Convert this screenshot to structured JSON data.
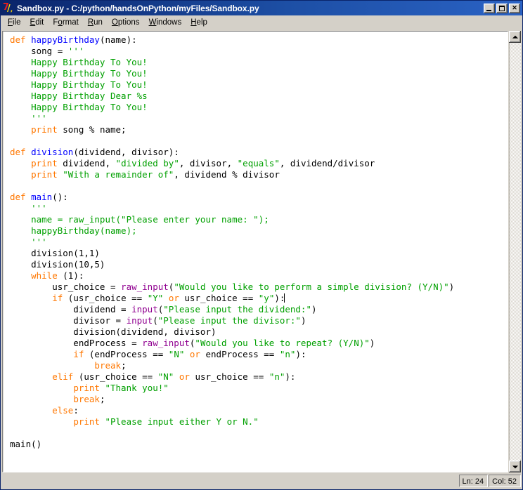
{
  "window": {
    "title": "Sandbox.py - C:/python/handsOnPython/myFiles/Sandbox.py",
    "icon": "python-logo-icon",
    "controls": {
      "minimize": "minimize-icon",
      "maximize": "maximize-icon",
      "close": "close-icon"
    }
  },
  "menubar": {
    "items": [
      {
        "label": "File",
        "accel": "F"
      },
      {
        "label": "Edit",
        "accel": "E"
      },
      {
        "label": "Format",
        "accel": "o"
      },
      {
        "label": "Run",
        "accel": "R"
      },
      {
        "label": "Options",
        "accel": "O"
      },
      {
        "label": "Windows",
        "accel": "W"
      },
      {
        "label": "Help",
        "accel": "H"
      }
    ]
  },
  "statusbar": {
    "line_label": "Ln: 24",
    "col_label": "Col: 52"
  },
  "scrollbar": {
    "up_icon": "scroll-up-arrow-icon",
    "down_icon": "scroll-down-arrow-icon"
  },
  "colors": {
    "keyword": "#ff7700",
    "definition": "#0000ff",
    "string": "#00a000",
    "builtin": "#900090",
    "plain": "#000000",
    "titlebar": "#0a246a",
    "chrome": "#d4d0c8",
    "editor_bg": "#ffffff"
  },
  "editor": {
    "filename": "Sandbox.py",
    "cursor_line": 24,
    "cursor_col": 52,
    "code_text": "def happyBirthday(name):\n    song = '''\n    Happy Birthday To You!\n    Happy Birthday To You!\n    Happy Birthday To You!\n    Happy Birthday Dear %s\n    Happy Birthday To You!\n    '''\n    print song % name;\n\ndef division(dividend, divisor):\n    print dividend, \"divided by\", divisor, \"equals\", dividend/divisor\n    print \"With a remainder of\", dividend % divisor\n\ndef main():\n    '''\n    name = raw_input(\"Please enter your name: \");\n    happyBirthday(name);\n    '''\n    division(1,1)\n    division(10,5)\n    while (1):\n        usr_choice = raw_input(\"Would you like to perform a simple division? (Y/N)\")\n        if (usr_choice == \"Y\" or usr_choice == \"y\"):\n            dividend = input(\"Please input the dividend:\")\n            divisor = input(\"Please input the divisor:\")\n            division(dividend, divisor)\n            endProcess = raw_input(\"Would you like to repeat? (Y/N)\")\n            if (endProcess == \"N\" or endProcess == \"n\"):\n                break;\n        elif (usr_choice == \"N\" or usr_choice == \"n\"):\n            print \"Thank you!\"\n            break;\n        else:\n            print \"Please input either Y or N.\"\n\nmain()",
    "lines": [
      {
        "n": 1,
        "tokens": [
          {
            "t": "def",
            "c": "kw"
          },
          {
            "t": " ",
            "c": "pl"
          },
          {
            "t": "happyBirthday",
            "c": "fn"
          },
          {
            "t": "(name):",
            "c": "pl"
          }
        ]
      },
      {
        "n": 2,
        "tokens": [
          {
            "t": "    song = ",
            "c": "pl"
          },
          {
            "t": "'''",
            "c": "str"
          }
        ]
      },
      {
        "n": 3,
        "tokens": [
          {
            "t": "    Happy Birthday To You!",
            "c": "str"
          }
        ]
      },
      {
        "n": 4,
        "tokens": [
          {
            "t": "    Happy Birthday To You!",
            "c": "str"
          }
        ]
      },
      {
        "n": 5,
        "tokens": [
          {
            "t": "    Happy Birthday To You!",
            "c": "str"
          }
        ]
      },
      {
        "n": 6,
        "tokens": [
          {
            "t": "    Happy Birthday Dear %s",
            "c": "str"
          }
        ]
      },
      {
        "n": 7,
        "tokens": [
          {
            "t": "    Happy Birthday To You!",
            "c": "str"
          }
        ]
      },
      {
        "n": 8,
        "tokens": [
          {
            "t": "    ",
            "c": "pl"
          },
          {
            "t": "'''",
            "c": "str"
          }
        ]
      },
      {
        "n": 9,
        "tokens": [
          {
            "t": "    ",
            "c": "pl"
          },
          {
            "t": "print",
            "c": "kw"
          },
          {
            "t": " song % name;",
            "c": "pl"
          }
        ]
      },
      {
        "n": 10,
        "tokens": []
      },
      {
        "n": 11,
        "tokens": [
          {
            "t": "def",
            "c": "kw"
          },
          {
            "t": " ",
            "c": "pl"
          },
          {
            "t": "division",
            "c": "fn"
          },
          {
            "t": "(dividend, divisor):",
            "c": "pl"
          }
        ]
      },
      {
        "n": 12,
        "tokens": [
          {
            "t": "    ",
            "c": "pl"
          },
          {
            "t": "print",
            "c": "kw"
          },
          {
            "t": " dividend, ",
            "c": "pl"
          },
          {
            "t": "\"divided by\"",
            "c": "str"
          },
          {
            "t": ", divisor, ",
            "c": "pl"
          },
          {
            "t": "\"equals\"",
            "c": "str"
          },
          {
            "t": ", dividend/divisor",
            "c": "pl"
          }
        ]
      },
      {
        "n": 13,
        "tokens": [
          {
            "t": "    ",
            "c": "pl"
          },
          {
            "t": "print",
            "c": "kw"
          },
          {
            "t": " ",
            "c": "pl"
          },
          {
            "t": "\"With a remainder of\"",
            "c": "str"
          },
          {
            "t": ", dividend % divisor",
            "c": "pl"
          }
        ]
      },
      {
        "n": 14,
        "tokens": []
      },
      {
        "n": 15,
        "tokens": [
          {
            "t": "def",
            "c": "kw"
          },
          {
            "t": " ",
            "c": "pl"
          },
          {
            "t": "main",
            "c": "fn"
          },
          {
            "t": "():",
            "c": "pl"
          }
        ]
      },
      {
        "n": 16,
        "tokens": [
          {
            "t": "    ",
            "c": "pl"
          },
          {
            "t": "'''",
            "c": "str"
          }
        ]
      },
      {
        "n": 17,
        "tokens": [
          {
            "t": "    name = raw_input(\"Please enter your name: \");",
            "c": "str"
          }
        ]
      },
      {
        "n": 18,
        "tokens": [
          {
            "t": "    happyBirthday(name);",
            "c": "str"
          }
        ]
      },
      {
        "n": 19,
        "tokens": [
          {
            "t": "    ",
            "c": "pl"
          },
          {
            "t": "'''",
            "c": "str"
          }
        ]
      },
      {
        "n": 20,
        "tokens": [
          {
            "t": "    division(1,1)",
            "c": "pl"
          }
        ]
      },
      {
        "n": 21,
        "tokens": [
          {
            "t": "    division(10,5)",
            "c": "pl"
          }
        ]
      },
      {
        "n": 22,
        "tokens": [
          {
            "t": "    ",
            "c": "pl"
          },
          {
            "t": "while",
            "c": "kw"
          },
          {
            "t": " (1):",
            "c": "pl"
          }
        ]
      },
      {
        "n": 23,
        "tokens": [
          {
            "t": "        usr_choice = ",
            "c": "pl"
          },
          {
            "t": "raw_input",
            "c": "bi"
          },
          {
            "t": "(",
            "c": "pl"
          },
          {
            "t": "\"Would you like to perform a simple division? (Y/N)\"",
            "c": "str"
          },
          {
            "t": ")",
            "c": "pl"
          }
        ]
      },
      {
        "n": 24,
        "tokens": [
          {
            "t": "        ",
            "c": "pl"
          },
          {
            "t": "if",
            "c": "kw"
          },
          {
            "t": " (usr_choice == ",
            "c": "pl"
          },
          {
            "t": "\"Y\"",
            "c": "str"
          },
          {
            "t": " ",
            "c": "pl"
          },
          {
            "t": "or",
            "c": "kw"
          },
          {
            "t": " usr_choice == ",
            "c": "pl"
          },
          {
            "t": "\"y\"",
            "c": "str"
          },
          {
            "t": "):",
            "c": "pl"
          }
        ],
        "caret": true
      },
      {
        "n": 25,
        "tokens": [
          {
            "t": "            dividend = ",
            "c": "pl"
          },
          {
            "t": "input",
            "c": "bi"
          },
          {
            "t": "(",
            "c": "pl"
          },
          {
            "t": "\"Please input the dividend:\"",
            "c": "str"
          },
          {
            "t": ")",
            "c": "pl"
          }
        ]
      },
      {
        "n": 26,
        "tokens": [
          {
            "t": "            divisor = ",
            "c": "pl"
          },
          {
            "t": "input",
            "c": "bi"
          },
          {
            "t": "(",
            "c": "pl"
          },
          {
            "t": "\"Please input the divisor:\"",
            "c": "str"
          },
          {
            "t": ")",
            "c": "pl"
          }
        ]
      },
      {
        "n": 27,
        "tokens": [
          {
            "t": "            division(dividend, divisor)",
            "c": "pl"
          }
        ]
      },
      {
        "n": 28,
        "tokens": [
          {
            "t": "            endProcess = ",
            "c": "pl"
          },
          {
            "t": "raw_input",
            "c": "bi"
          },
          {
            "t": "(",
            "c": "pl"
          },
          {
            "t": "\"Would you like to repeat? (Y/N)\"",
            "c": "str"
          },
          {
            "t": ")",
            "c": "pl"
          }
        ]
      },
      {
        "n": 29,
        "tokens": [
          {
            "t": "            ",
            "c": "pl"
          },
          {
            "t": "if",
            "c": "kw"
          },
          {
            "t": " (endProcess == ",
            "c": "pl"
          },
          {
            "t": "\"N\"",
            "c": "str"
          },
          {
            "t": " ",
            "c": "pl"
          },
          {
            "t": "or",
            "c": "kw"
          },
          {
            "t": " endProcess == ",
            "c": "pl"
          },
          {
            "t": "\"n\"",
            "c": "str"
          },
          {
            "t": "):",
            "c": "pl"
          }
        ]
      },
      {
        "n": 30,
        "tokens": [
          {
            "t": "                ",
            "c": "pl"
          },
          {
            "t": "break",
            "c": "kw"
          },
          {
            "t": ";",
            "c": "pl"
          }
        ]
      },
      {
        "n": 31,
        "tokens": [
          {
            "t": "        ",
            "c": "pl"
          },
          {
            "t": "elif",
            "c": "kw"
          },
          {
            "t": " (usr_choice == ",
            "c": "pl"
          },
          {
            "t": "\"N\"",
            "c": "str"
          },
          {
            "t": " ",
            "c": "pl"
          },
          {
            "t": "or",
            "c": "kw"
          },
          {
            "t": " usr_choice == ",
            "c": "pl"
          },
          {
            "t": "\"n\"",
            "c": "str"
          },
          {
            "t": "):",
            "c": "pl"
          }
        ]
      },
      {
        "n": 32,
        "tokens": [
          {
            "t": "            ",
            "c": "pl"
          },
          {
            "t": "print",
            "c": "kw"
          },
          {
            "t": " ",
            "c": "pl"
          },
          {
            "t": "\"Thank you!\"",
            "c": "str"
          }
        ]
      },
      {
        "n": 33,
        "tokens": [
          {
            "t": "            ",
            "c": "pl"
          },
          {
            "t": "break",
            "c": "kw"
          },
          {
            "t": ";",
            "c": "pl"
          }
        ]
      },
      {
        "n": 34,
        "tokens": [
          {
            "t": "        ",
            "c": "pl"
          },
          {
            "t": "else",
            "c": "kw"
          },
          {
            "t": ":",
            "c": "pl"
          }
        ]
      },
      {
        "n": 35,
        "tokens": [
          {
            "t": "            ",
            "c": "pl"
          },
          {
            "t": "print",
            "c": "kw"
          },
          {
            "t": " ",
            "c": "pl"
          },
          {
            "t": "\"Please input either Y or N.\"",
            "c": "str"
          }
        ]
      },
      {
        "n": 36,
        "tokens": []
      },
      {
        "n": 37,
        "tokens": [
          {
            "t": "main()",
            "c": "pl"
          }
        ]
      }
    ]
  }
}
